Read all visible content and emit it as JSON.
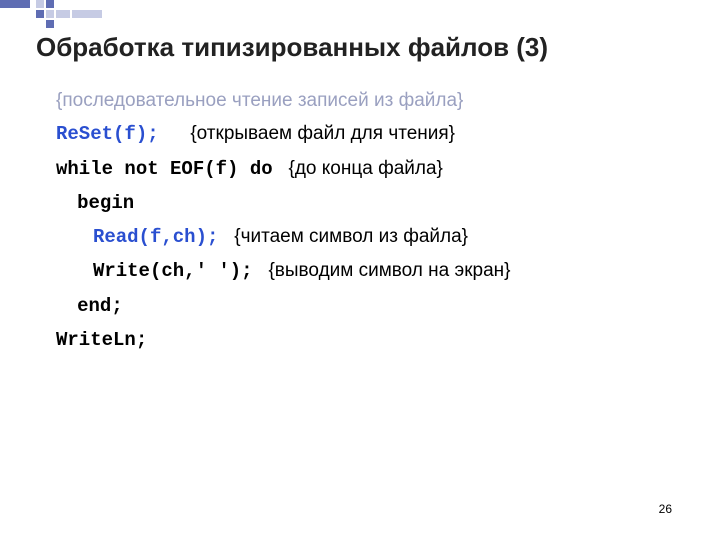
{
  "colors": {
    "accent_dark": "#5f6db3",
    "accent_light": "#c6cbe4",
    "highlight": "#2a4fd0",
    "muted": "#9aa0c0"
  },
  "title": "Обработка типизированных файлов (3)",
  "header_comment": "{последовательное чтение записей из файла}",
  "lines": {
    "l1_code": "ReSet(f);",
    "l1_cmt": "{открываем файл для чтения}",
    "l2_code": "while not EOF(f) do",
    "l2_cmt": "{до конца файла}",
    "l3_code": "begin",
    "l4_code": "Read(f,ch);",
    "l4_cmt": "{читаем символ из файла}",
    "l5_code": "Write(ch,' ');",
    "l5_cmt": "{выводим символ на экран}",
    "l6_code": "end;",
    "l7_code": "WriteLn;"
  },
  "page_number": "26"
}
